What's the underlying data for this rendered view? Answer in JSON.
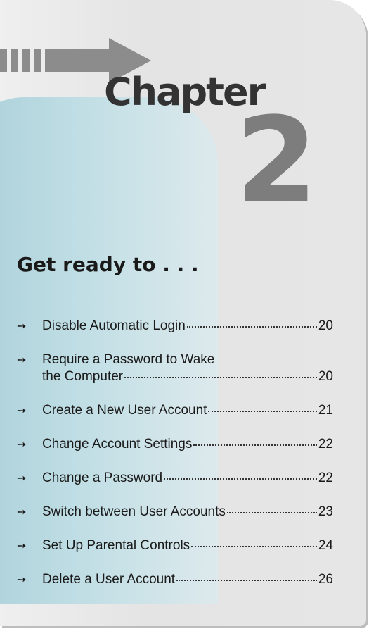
{
  "chapter": {
    "label": "Chapter",
    "number": "2"
  },
  "heading": "Get ready to . . .",
  "arrow_glyph": "➙",
  "toc": [
    {
      "lines": [
        "Disable Automatic Login"
      ],
      "page": "20"
    },
    {
      "lines": [
        "Require a Password to Wake",
        "the Computer"
      ],
      "page": "20"
    },
    {
      "lines": [
        "Create a New User Account"
      ],
      "page": "21"
    },
    {
      "lines": [
        "Change Account Settings"
      ],
      "page": "22"
    },
    {
      "lines": [
        "Change a Password"
      ],
      "page": "22"
    },
    {
      "lines": [
        "Switch between User Accounts"
      ],
      "page": "23"
    },
    {
      "lines": [
        "Set Up Parental Controls"
      ],
      "page": "24"
    },
    {
      "lines": [
        "Delete a User Account"
      ],
      "page": "26"
    }
  ],
  "colors": {
    "blob": "#a9cfd9",
    "arrow": "#8c8c8c",
    "number": "#7d7d7d"
  }
}
